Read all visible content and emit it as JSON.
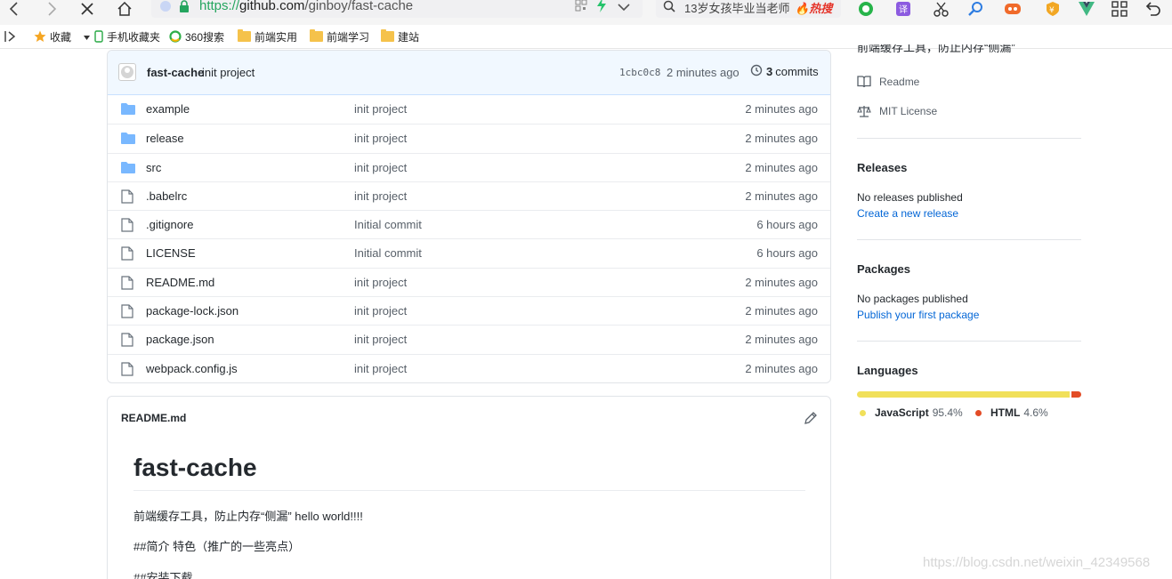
{
  "browser": {
    "url_scheme": "https://",
    "url_host": "github.com",
    "url_path": "/ginboy/fast-cache",
    "search_text": "13岁女孩毕业当老师",
    "search_badge": "热搜",
    "bookmarks": [
      {
        "label": "收藏"
      },
      {
        "label": "手机收藏夹"
      },
      {
        "label": "360搜索"
      },
      {
        "label": "前端实用"
      },
      {
        "label": "前端学习"
      },
      {
        "label": "建站"
      }
    ]
  },
  "repo": {
    "latest_commit": {
      "author": "fast-cache",
      "message": "init project",
      "sha": "1cbc0c8",
      "time": "2 minutes ago",
      "count": "3",
      "count_label": "commits"
    },
    "files": [
      {
        "name": "example",
        "type": "folder",
        "commit": "init project",
        "time": "2 minutes ago"
      },
      {
        "name": "release",
        "type": "folder",
        "commit": "init project",
        "time": "2 minutes ago"
      },
      {
        "name": "src",
        "type": "folder",
        "commit": "init project",
        "time": "2 minutes ago"
      },
      {
        "name": ".babelrc",
        "type": "file",
        "commit": "init project",
        "time": "2 minutes ago"
      },
      {
        "name": ".gitignore",
        "type": "file",
        "commit": "Initial commit",
        "time": "6 hours ago"
      },
      {
        "name": "LICENSE",
        "type": "file",
        "commit": "Initial commit",
        "time": "6 hours ago"
      },
      {
        "name": "README.md",
        "type": "file",
        "commit": "init project",
        "time": "2 minutes ago"
      },
      {
        "name": "package-lock.json",
        "type": "file",
        "commit": "init project",
        "time": "2 minutes ago"
      },
      {
        "name": "package.json",
        "type": "file",
        "commit": "init project",
        "time": "2 minutes ago"
      },
      {
        "name": "webpack.config.js",
        "type": "file",
        "commit": "init project",
        "time": "2 minutes ago"
      }
    ]
  },
  "readme": {
    "header": "README.md",
    "title": "fast-cache",
    "paragraphs": [
      "前端缓存工具，防止内存“侧漏” hello world!!!!",
      "##简介 特色（推广的一些亮点）",
      "##安装下载"
    ]
  },
  "sidebar": {
    "about_text": "前端缓存工具，防止内存“侧漏”",
    "readme_link": "Readme",
    "license_link": "MIT License",
    "releases": {
      "heading": "Releases",
      "text": "No releases published",
      "link": "Create a new release"
    },
    "packages": {
      "heading": "Packages",
      "text": "No packages published",
      "link": "Publish your first package"
    },
    "languages": {
      "heading": "Languages",
      "items": [
        {
          "name": "JavaScript",
          "percent_label": "95.4%",
          "percent": 95.4,
          "color": "#f1e05a"
        },
        {
          "name": "HTML",
          "percent_label": "4.6%",
          "percent": 4.6,
          "color": "#e34c26"
        }
      ]
    }
  },
  "watermark": "https://blog.csdn.net/weixin_42349568"
}
